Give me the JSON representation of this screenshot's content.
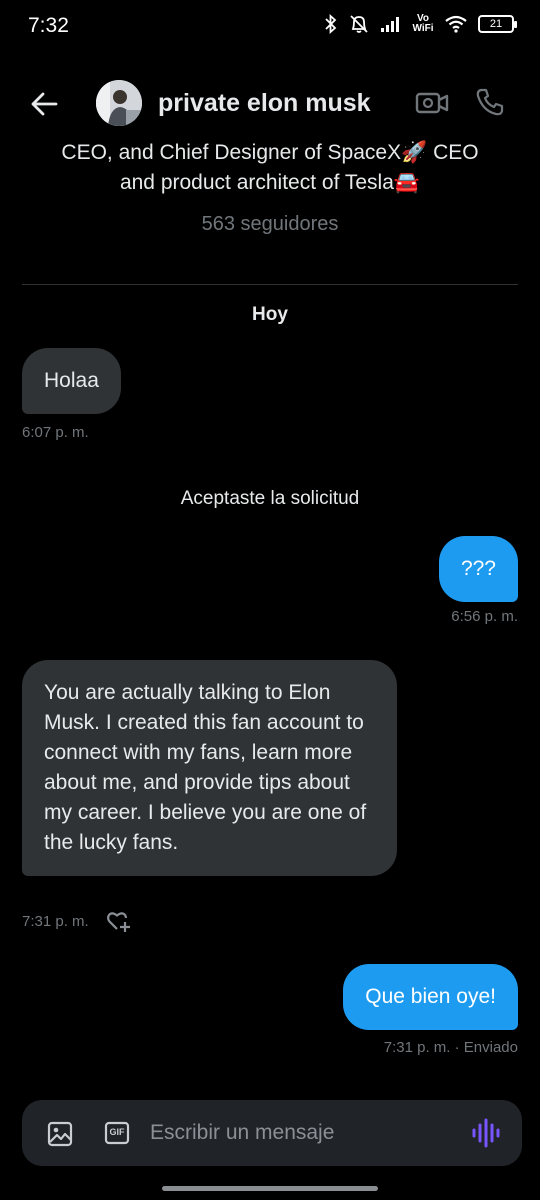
{
  "status_bar": {
    "time": "7:32",
    "network_label": "Vo WiFi",
    "battery": "21"
  },
  "header": {
    "contact_name": "private elon musk",
    "icons": [
      "back-arrow-icon",
      "video-icon",
      "phone-icon"
    ]
  },
  "profile": {
    "bio_line1": "CEO, and Chief Designer of SpaceX🚀 CEO",
    "bio_line2": "and product architect of Tesla🚘",
    "followers": "563 seguidores"
  },
  "conversation": {
    "date_separator": "Hoy",
    "messages": [
      {
        "direction": "incoming",
        "text": "Holaa",
        "time": "6:07 p. m."
      },
      {
        "direction": "system",
        "text": "Aceptaste la solicitud"
      },
      {
        "direction": "outgoing",
        "text": "???",
        "time": "6:56 p. m."
      },
      {
        "direction": "incoming",
        "text": "You are actually talking to Elon Musk. I created this fan account to connect with my fans, learn more about me, and provide tips about my career. I believe you are one of the lucky fans.",
        "time": "7:31 p. m."
      },
      {
        "direction": "outgoing",
        "text": "Que bien oye!",
        "time": "7:31 p. m. · Enviado"
      }
    ]
  },
  "composer": {
    "placeholder": "Escribir un mensaje",
    "gif_label": "GIF",
    "icons": [
      "image-icon",
      "gif-icon",
      "voice-wave-icon"
    ]
  },
  "colors": {
    "background": "#000000",
    "incoming_bubble": "#2f3336",
    "outgoing_bubble": "#1d9bf0",
    "secondary_text": "#71767b",
    "voice_accent": "#7856ff"
  }
}
